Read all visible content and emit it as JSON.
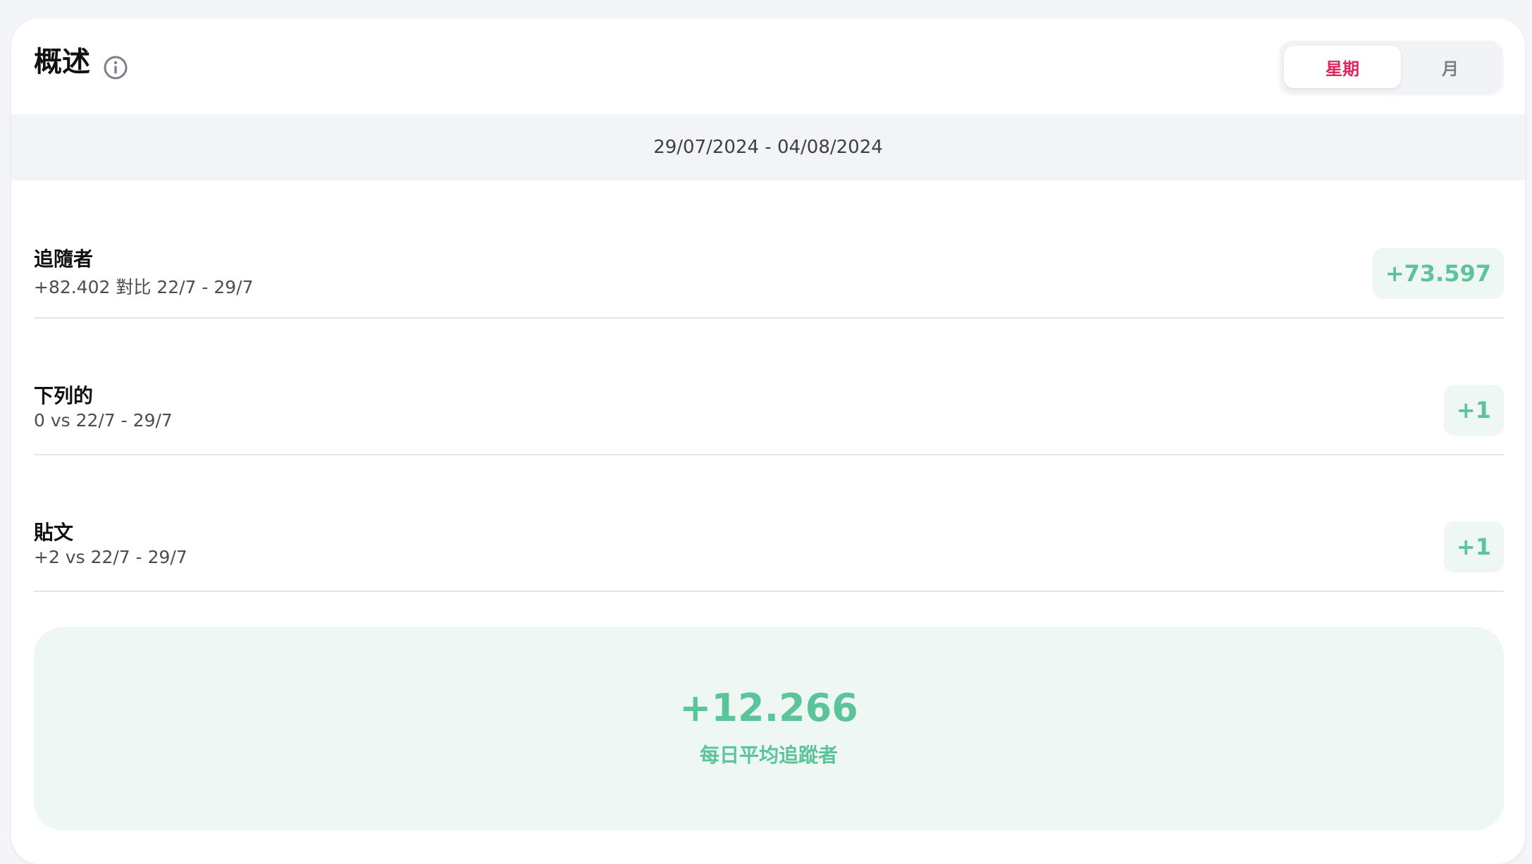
{
  "overview": {
    "title": "概述",
    "info_icon": "info-circle-icon"
  },
  "period_toggle": {
    "options": [
      "星期",
      "月"
    ],
    "selected": "星期"
  },
  "date_range": "29/07/2024 - 04/08/2024",
  "metrics": [
    {
      "label": "追隨者",
      "comparison": "+82.402 對比 22/7 - 29/7",
      "change": "+73.597"
    },
    {
      "label": "下列的",
      "comparison": "0 vs 22/7 - 29/7",
      "change": "+1"
    },
    {
      "label": "貼文",
      "comparison": "+2 vs 22/7 - 29/7",
      "change": "+1"
    }
  ],
  "daily_average": {
    "value": "+12.266",
    "caption": "每日平均追蹤者"
  },
  "colors": {
    "accent_pink": "#e0245e",
    "positive_green": "#5cc49a",
    "positive_bg": "#eef7f3"
  }
}
